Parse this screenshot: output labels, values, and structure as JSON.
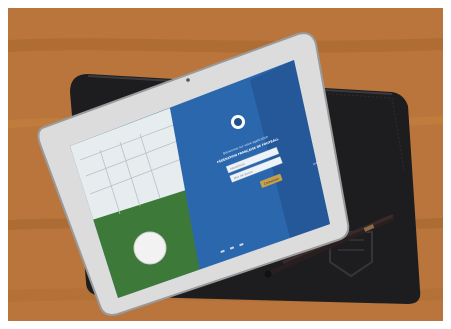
{
  "photo": {
    "subject": "tablet-on-leather-sleeve",
    "colors": {
      "table_wood": "#b9753b",
      "table_wood_dark": "#8f5428",
      "sleeve_leather": "#1d1d20",
      "sleeve_highlight": "#3a3a3e",
      "tablet_bezel": "#dcdcdc",
      "tablet_frame_edge": "#9a9a9a",
      "screen_blue": "#2e6eb5",
      "screen_blue_dark": "#1f4f8c",
      "grass": "#3d7a3a",
      "goal_net": "#e7ecef",
      "button_gold": "#c7a14b",
      "stylus": "#2a1f1f"
    }
  },
  "screen": {
    "welcome_line1": "Bienvenue sur votre application",
    "welcome_line2": "FÉDÉRATION FRANÇAISE DE FOOTBALL",
    "field1_placeholder": "Identifiant",
    "field2_placeholder": "Mot de passe",
    "login_button": "Connexion",
    "footer_link": "Aide"
  }
}
